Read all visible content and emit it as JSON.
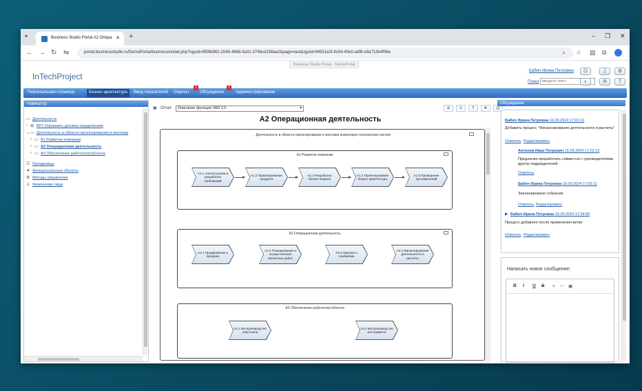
{
  "browser": {
    "tab_title": "Business Studio Portal A2 Опера",
    "url": "portal.businessstudio.ru/DemoPortal/businessmodel.php?oguid=8f59b962-2048-4668-9a31-374bcd158ae2&page=last&rguid=94551e2f-8c54-40e0-adf8-e9a713b4f06e"
  },
  "portal": {
    "site_title": "Business Studio Portal - DemoPortal",
    "logo": "InTechProject",
    "user_name": "Бабич Ирина Петровна",
    "search_link": "Поиск",
    "search_placeholder": "введите текст"
  },
  "menu": {
    "items": [
      "Персональная страница",
      "Бизнес-архитектура",
      "Ввод показателей",
      "Опросы",
      "Обсуждения",
      "Администрирование"
    ],
    "badges": {
      "surveys": "1",
      "discussions": "1"
    }
  },
  "navigator": {
    "title": "Навигатор",
    "items": [
      "Деятельность",
      "ВР1 Оформить договор юридическим",
      "Деятельность в области проектирования и монтажа",
      "А1 Развитие компании",
      "А2 Операционная деятельность",
      "А3 Обеспечение работоспособности",
      "Оргединицы",
      "Функциональные объекты",
      "Методы управления",
      "Физические лица"
    ]
  },
  "report": {
    "label": "Отчет",
    "selected": "Описание функции VAD 2.0",
    "page_title": "А2 Операционная деятельность"
  },
  "diagram": {
    "outer_title": "Деятельность в области проектирования и монтажа инженерно-технических систем",
    "lanes": [
      {
        "title": "А1 Развитие компании",
        "functions": [
          "А1.1 Анализ рынка и разработка требований",
          "А1.2 Проектирование продукта",
          "А1.3 Разработка бизнес-модели",
          "А1.4 Проектирование бизнес-архитектуры",
          "А1.5 Проведение орг.изменений"
        ]
      },
      {
        "title": "А2 Операционная деятельность",
        "functions": [
          "А2.1 Продвижение и продажи",
          "А2.2 Планирование и осуществление проектных работ",
          "А2.3 Закупки и снабжение",
          "А2.4 Финансирование деятельности и расчеты"
        ]
      },
      {
        "title": "А3 Обеспечение работоспособности",
        "functions": [
          "А3.1 Воспроизводство персонала",
          "А3.2 Воспроизводство инструмента"
        ]
      }
    ]
  },
  "discussion": {
    "title": "Обсуждение",
    "comments": [
      {
        "author": "Бабич Ирина Петровна",
        "date": "16.09.2024 17:01:10",
        "text": "Добавить процесс \"Финансирование деятельности и расчеты\"",
        "links": [
          "Ответить",
          "Редактировать"
        ]
      },
      {
        "author": "Антонов Иван Петрович",
        "date": "16.09.2024 17:02:13",
        "text": "Предлагаю проработать совместно с руководителями других подразделений",
        "links": [
          "Ответить"
        ]
      },
      {
        "author": "Бабич Ирина Петровна",
        "date": "16.09.2024 17:03:11",
        "text": "Запланировано собрание",
        "links": [
          "Ответить",
          "Редактировать"
        ]
      },
      {
        "author": "Бабич Ирина Петровна",
        "date": "16.09.2024 17:04:05",
        "text": "Процесс добавлен после применения ветки",
        "links": [
          "Ответить",
          "Редактировать"
        ]
      }
    ],
    "new_message_label": "Написать новое сообщение:",
    "editor_tools": [
      "B",
      "I",
      "U",
      "S"
    ]
  },
  "icons": [
    "menu-dropdown-icon",
    "favicon-icon",
    "back-icon",
    "forward-icon",
    "reload-icon",
    "site-info-icon",
    "zoom-icon",
    "star-icon",
    "reading-list-icon",
    "extensions-icon",
    "profile-icon",
    "power-icon",
    "phone-icon",
    "settings-icon",
    "chat-icon",
    "help-icon",
    "folder-icon",
    "process-icon",
    "org-icon",
    "functional-object-icon",
    "methods-icon",
    "person-icon",
    "print-icon",
    "link-icon",
    "image-icon"
  ],
  "colors": {
    "menu": "#2f6cc1",
    "link": "#1e5aa8",
    "frame": "#0c5e78",
    "badge": "#d8262c"
  }
}
